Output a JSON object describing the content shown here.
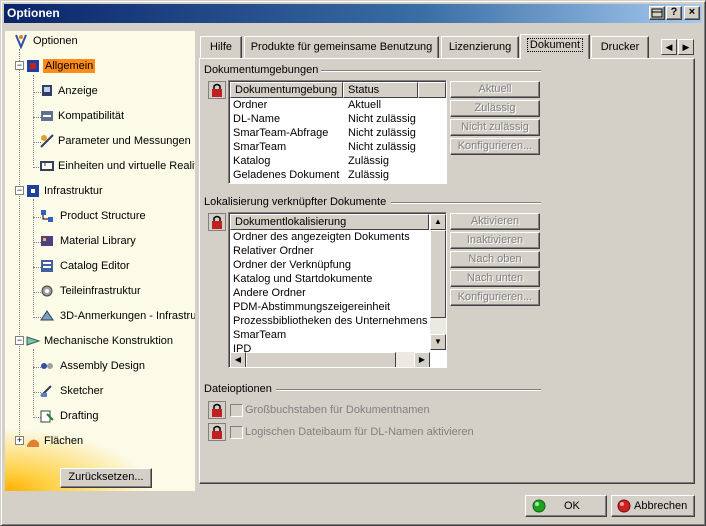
{
  "window": {
    "title": "Optionen"
  },
  "titlebar_buttons": {
    "help": "?",
    "close": "×"
  },
  "tree": {
    "items": [
      {
        "label": "Optionen",
        "icon": "options-tree-root-icon"
      },
      {
        "label": "Allgemein",
        "icon": "general-icon"
      },
      {
        "label": "Anzeige",
        "icon": "display-icon"
      },
      {
        "label": "Kompatibilität",
        "icon": "compatibility-icon"
      },
      {
        "label": "Parameter und Messungen",
        "icon": "parameters-icon"
      },
      {
        "label": "Einheiten und virtuelle Realit",
        "icon": "units-icon"
      },
      {
        "label": "Infrastruktur",
        "icon": "infrastructure-icon"
      },
      {
        "label": "Product Structure",
        "icon": "product-structure-icon"
      },
      {
        "label": "Material Library",
        "icon": "material-library-icon"
      },
      {
        "label": "Catalog Editor",
        "icon": "catalog-editor-icon"
      },
      {
        "label": "Teileinfrastruktur",
        "icon": "part-infrastructure-icon"
      },
      {
        "label": "3D-Anmerkungen - Infrastru",
        "icon": "3d-annotations-icon"
      },
      {
        "label": "Mechanische Konstruktion",
        "icon": "mechanical-design-icon"
      },
      {
        "label": "Assembly Design",
        "icon": "assembly-design-icon"
      },
      {
        "label": "Sketcher",
        "icon": "sketcher-icon"
      },
      {
        "label": "Drafting",
        "icon": "drafting-icon"
      },
      {
        "label": "Flächen",
        "icon": "surfaces-icon"
      }
    ],
    "reset_label": "Zurücksetzen..."
  },
  "tabs": [
    {
      "label": "Hilfe"
    },
    {
      "label": "Produkte für gemeinsame Benutzung"
    },
    {
      "label": "Lizenzierung"
    },
    {
      "label": "Dokument"
    },
    {
      "label": "Drucker"
    }
  ],
  "environments": {
    "title": "Dokumentumgebungen",
    "columns": [
      "Dokumentumgebung",
      "Status"
    ],
    "rows": [
      [
        "Ordner",
        "Aktuell"
      ],
      [
        "DL-Name",
        "Nicht zulässig"
      ],
      [
        "SmarTeam-Abfrage",
        "Nicht zulässig"
      ],
      [
        "SmarTeam",
        "Nicht zulässig"
      ],
      [
        "Katalog",
        "Zulässig"
      ],
      [
        "Geladenes Dokument",
        "Zulässig"
      ]
    ],
    "buttons": [
      "Aktuell",
      "Zulässig",
      "Nicht zulässig",
      "Konfigurieren..."
    ]
  },
  "linked": {
    "title": "Lokalisierung verknüpfter Dokumente",
    "column": "Dokumentlokalisierung",
    "rows": [
      "Ordner des angezeigten Dokuments",
      "Relativer Ordner",
      "Ordner der Verknüpfung",
      "Katalog und Startdokumente",
      "Andere Ordner",
      "PDM-Abstimmungszeigereinheit",
      "Prozessbibliotheken des Unternehmens",
      "SmarTeam",
      "IPD"
    ],
    "buttons": [
      "Aktivieren",
      "Inaktivieren",
      "Nach oben",
      "Nach unten",
      "Konfigurieren..."
    ]
  },
  "file_options": {
    "title": "Dateioptionen",
    "options": [
      {
        "label": "Großbuchstaben für Dokumentnamen",
        "checked": false
      },
      {
        "label": "Logischen Dateibaum für DL-Namen aktivieren",
        "checked": false
      }
    ]
  },
  "footer": {
    "ok": "OK",
    "cancel": "Abbrechen"
  },
  "colors": {
    "titlebar": "#0a246a",
    "selection": "#ff8c1a",
    "tree_bg": "#fbfbe8"
  }
}
